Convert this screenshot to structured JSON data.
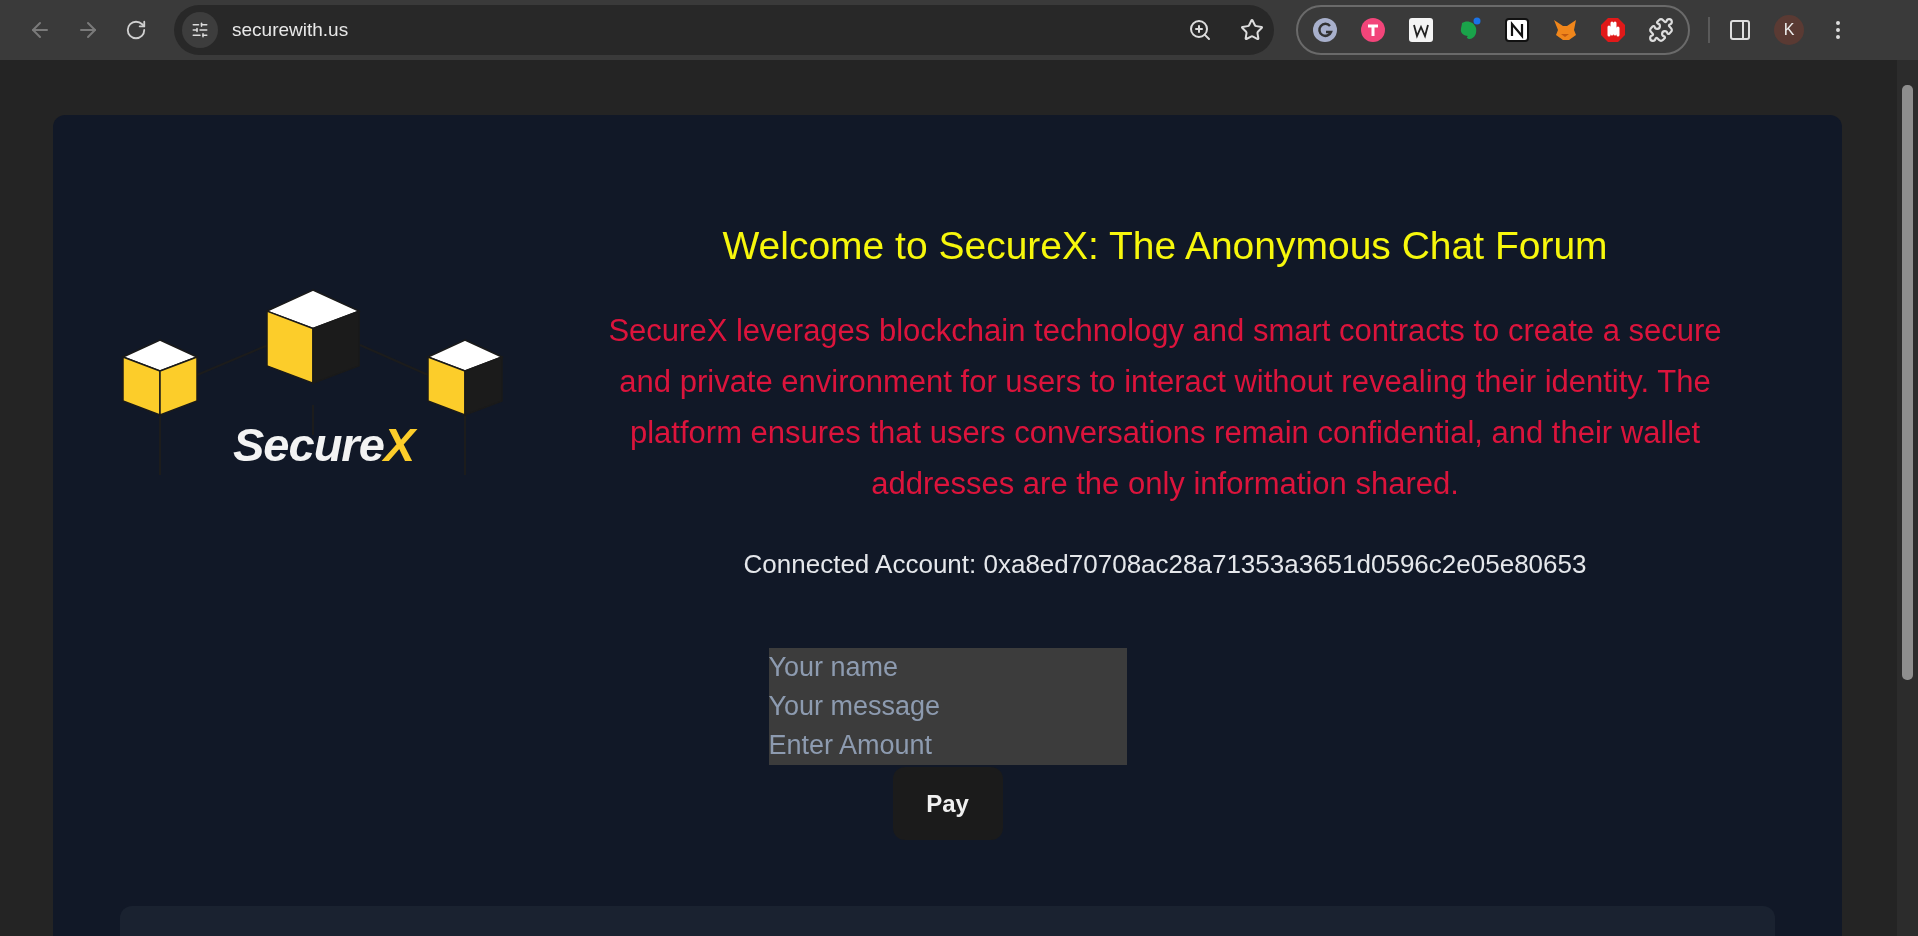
{
  "browser": {
    "address": "securewith.us",
    "profile_initial": "K"
  },
  "logo": {
    "text": "Secure",
    "accent": "X"
  },
  "intro": {
    "title": "Welcome to SecureX: The Anonymous Chat Forum",
    "description": "SecureX leverages blockchain technology and smart contracts to create a secure and private environment for users to interact without revealing their identity. The platform ensures that users conversations remain confidential, and their wallet addresses are the only information shared.",
    "account": "Connected Account: 0xa8ed70708ac28a71353a3651d0596c2e05e80653"
  },
  "form": {
    "fields": [
      {
        "placeholder": "Your name"
      },
      {
        "placeholder": "Your message"
      },
      {
        "placeholder": "Enter Amount"
      }
    ],
    "button": "Pay"
  }
}
